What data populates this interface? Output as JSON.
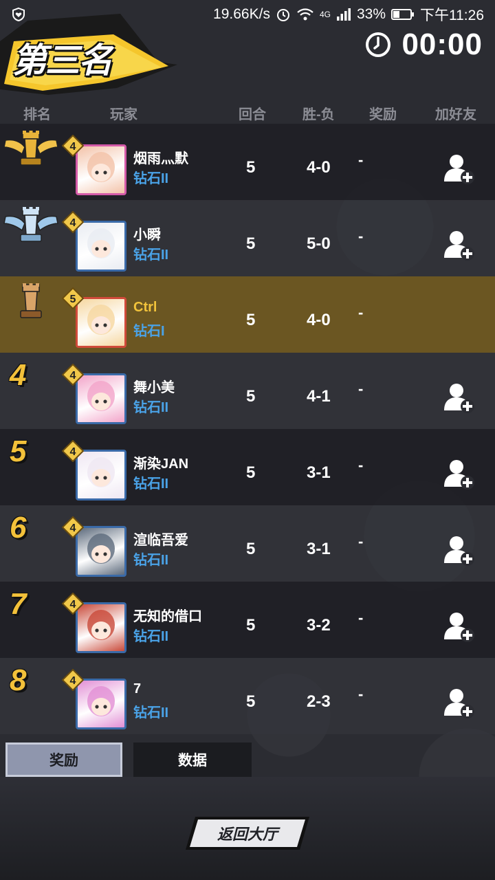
{
  "status_bar": {
    "network_speed": "19.66K/s",
    "network_type": "4G",
    "battery": "33%",
    "time": "下午11:26"
  },
  "header": {
    "placement": "第三名",
    "timer": "00:00"
  },
  "columns": {
    "rank": "排名",
    "player": "玩家",
    "rounds": "回合",
    "win_loss": "胜-负",
    "reward": "奖励",
    "add_friend": "加好友"
  },
  "rows": [
    {
      "rank": "1",
      "level": "4",
      "name": "烟雨灬默",
      "tier": "钻石II",
      "rounds": "5",
      "wl": "4-0",
      "reward": "-",
      "is_me": false,
      "trophy": "gold"
    },
    {
      "rank": "2",
      "level": "4",
      "name": "小瞬",
      "tier": "钻石II",
      "rounds": "5",
      "wl": "5-0",
      "reward": "-",
      "is_me": false,
      "trophy": "silver"
    },
    {
      "rank": "3",
      "level": "5",
      "name": "Ctrl",
      "tier": "钻石I",
      "rounds": "5",
      "wl": "4-0",
      "reward": "-",
      "is_me": true,
      "trophy": "bronze"
    },
    {
      "rank": "4",
      "level": "4",
      "name": "舞小美",
      "tier": "钻石II",
      "rounds": "5",
      "wl": "4-1",
      "reward": "-",
      "is_me": false
    },
    {
      "rank": "5",
      "level": "4",
      "name": "渐染JAN",
      "tier": "钻石II",
      "rounds": "5",
      "wl": "3-1",
      "reward": "-",
      "is_me": false
    },
    {
      "rank": "6",
      "level": "4",
      "name": "渲临吾爱",
      "tier": "钻石II",
      "rounds": "5",
      "wl": "3-1",
      "reward": "-",
      "is_me": false
    },
    {
      "rank": "7",
      "level": "4",
      "name": "无知的借口",
      "tier": "钻石II",
      "rounds": "5",
      "wl": "3-2",
      "reward": "-",
      "is_me": false
    },
    {
      "rank": "8",
      "level": "4",
      "name": "7",
      "tier": "钻石II",
      "rounds": "5",
      "wl": "2-3",
      "reward": "-",
      "is_me": false
    }
  ],
  "tabs": {
    "reward": "奖励",
    "data": "数据"
  },
  "back_button": "返回大厅",
  "colors": {
    "gold": "#f3c13a",
    "tier_blue": "#4aa3e8",
    "me_row": "#6b5622"
  },
  "icons": {
    "status_left": "shield-heart-icon",
    "alarm": "alarm-icon",
    "wifi": "wifi-icon",
    "signal": "signal-icon",
    "battery": "battery-icon",
    "clock": "clock-icon",
    "add_friend": "add-friend-icon"
  }
}
